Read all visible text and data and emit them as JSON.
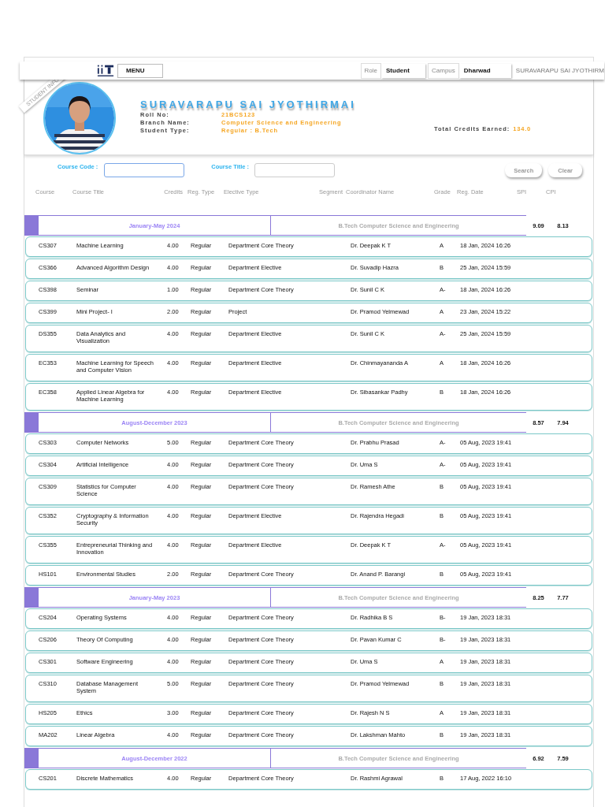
{
  "header": {
    "menu": "MENU",
    "role_label": "Role",
    "role": "Student",
    "campus_label": "Campus",
    "campus": "Dharwad",
    "user": "SURAVARAPU SAI JYOTHIRM"
  },
  "ribbon": "STUDENT INFO",
  "profile": {
    "name": "SURAVARAPU SAI JYOTHIRMAI",
    "fields": [
      {
        "label": "Roll No:",
        "value": "21BCS123"
      },
      {
        "label": "Branch Name:",
        "value": "Computer Science and Engineering"
      },
      {
        "label": "Student Type:",
        "value": "Regular : B.Tech"
      }
    ],
    "credits_label": "Total Credits Earned:",
    "credits": "134.0"
  },
  "filters": {
    "fields": [
      {
        "label": "Course Code :"
      },
      {
        "label": "Course Title :"
      }
    ],
    "buttons": [
      "Search",
      "Clear"
    ]
  },
  "columns": [
    "Course",
    "Course Title",
    "Credits",
    "Reg. Type",
    "Elective Type",
    "Segment",
    "Coordinator Name",
    "Grade",
    "Reg. Date",
    "SPI",
    "CPI"
  ],
  "semesters": [
    {
      "term": "January-May 2024",
      "program": "B.Tech Computer Science and Engineering",
      "spi": "9.09",
      "cpi": "8.13",
      "courses": [
        [
          "CS307",
          "Machine Learning",
          "4.00",
          "Regular",
          "Department Core Theory",
          "Dr. Deepak K T",
          "A",
          "18 Jan, 2024 16:26"
        ],
        [
          "CS366",
          "Advanced Algorithm Design",
          "4.00",
          "Regular",
          "Department Elective",
          "Dr. Suvadip Hazra",
          "B",
          "25 Jan, 2024 15:59"
        ],
        [
          "CS398",
          "Seminar",
          "1.00",
          "Regular",
          "Department Core Theory",
          "Dr. Sunil C K",
          "A-",
          "18 Jan, 2024 16:26"
        ],
        [
          "CS399",
          "Mini Project- I",
          "2.00",
          "Regular",
          "Project",
          "Dr. Pramod Yelmewad",
          "A",
          "23 Jan, 2024 15:22"
        ],
        [
          "DS355",
          "Data Analytics and Visualization",
          "4.00",
          "Regular",
          "Department Elective",
          "Dr. Sunil C K",
          "A-",
          "25 Jan, 2024 15:59"
        ],
        [
          "EC353",
          "Machine Learning for Speech and Computer Vision",
          "4.00",
          "Regular",
          "Department Elective",
          "Dr. Chinmayananda A",
          "A",
          "18 Jan, 2024 16:26"
        ],
        [
          "EC358",
          "Applied Linear Algebra for Machine Learning",
          "4.00",
          "Regular",
          "Department Elective",
          "Dr. Sibasankar Padhy",
          "B",
          "18 Jan, 2024 16:26"
        ]
      ]
    },
    {
      "term": "August-December 2023",
      "program": "B.Tech Computer Science and Engineering",
      "spi": "8.57",
      "cpi": "7.94",
      "courses": [
        [
          "CS303",
          "Computer Networks",
          "5.00",
          "Regular",
          "Department Core Theory",
          "Dr. Prabhu Prasad",
          "A-",
          "05 Aug, 2023 19:41"
        ],
        [
          "CS304",
          "Artificial Intelligence",
          "4.00",
          "Regular",
          "Department Core Theory",
          "Dr. Uma S",
          "A-",
          "05 Aug, 2023 19:41"
        ],
        [
          "CS309",
          "Statistics for Computer Science",
          "4.00",
          "Regular",
          "Department Core Theory",
          "Dr. Ramesh Athe",
          "B",
          "05 Aug, 2023 19:41"
        ],
        [
          "CS352",
          "Cryptography & Information Security",
          "4.00",
          "Regular",
          "Department Elective",
          "Dr. Rajendra Hegadi",
          "B",
          "05 Aug, 2023 19:41"
        ],
        [
          "CS355",
          "Entrepreneurial Thinking and Innovation",
          "4.00",
          "Regular",
          "Department Elective",
          "Dr. Deepak K T",
          "A-",
          "05 Aug, 2023 19:41"
        ],
        [
          "HS101",
          "Environmental Studies",
          "2.00",
          "Regular",
          "Department Core Theory",
          "Dr. Anand P. Barangi",
          "B",
          "05 Aug, 2023 19:41"
        ]
      ]
    },
    {
      "term": "January-May 2023",
      "program": "B.Tech Computer Science and Engineering",
      "spi": "8.25",
      "cpi": "7.77",
      "courses": [
        [
          "CS204",
          "Operating Systems",
          "4.00",
          "Regular",
          "Department Core Theory",
          "Dr. Radhika B S",
          "B-",
          "19 Jan, 2023 18:31"
        ],
        [
          "CS206",
          "Theory Of Computing",
          "4.00",
          "Regular",
          "Department Core Theory",
          "Dr. Pavan Kumar C",
          "B-",
          "19 Jan, 2023 18:31"
        ],
        [
          "CS301",
          "Software Engineering",
          "4.00",
          "Regular",
          "Department Core Theory",
          "Dr. Uma S",
          "A",
          "19 Jan, 2023 18:31"
        ],
        [
          "CS310",
          "Database Management System",
          "5.00",
          "Regular",
          "Department Core Theory",
          "Dr. Pramod Yelmewad",
          "B",
          "19 Jan, 2023 18:31"
        ],
        [
          "HS205",
          "Ethics",
          "3.00",
          "Regular",
          "Department Core Theory",
          "Dr. Rajesh N S",
          "A",
          "19 Jan, 2023 18:31"
        ],
        [
          "MA202",
          "Linear Algebra",
          "4.00",
          "Regular",
          "Department Core Theory",
          "Dr. Lakshman Mahto",
          "B",
          "19 Jan, 2023 18:31"
        ]
      ]
    },
    {
      "term": "August-December 2022",
      "program": "B.Tech Computer Science and Engineering",
      "spi": "6.92",
      "cpi": "7.59",
      "courses": [
        [
          "CS201",
          "Discrete Mathematics",
          "4.00",
          "Regular",
          "Department Core Theory",
          "Dr. Rashmi Agrawal",
          "B",
          "17 Aug, 2022 16:10"
        ]
      ]
    }
  ]
}
